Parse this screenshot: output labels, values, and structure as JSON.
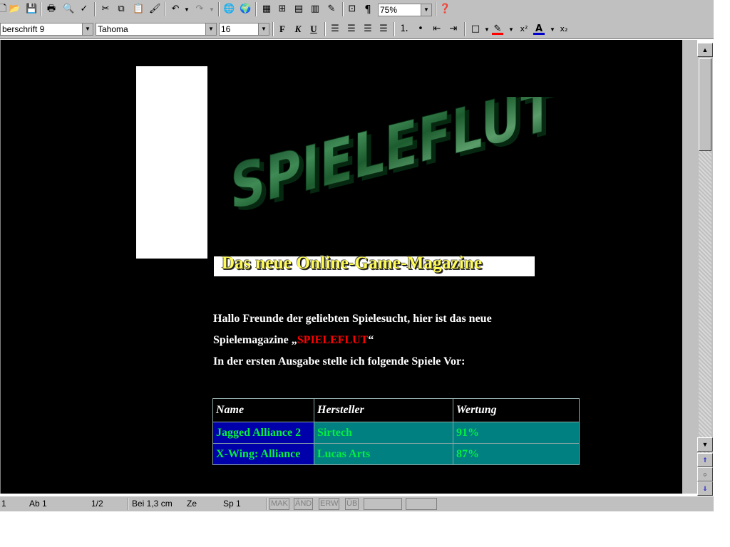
{
  "toolbar_standard": {
    "zoom": "75%"
  },
  "toolbar_format": {
    "style": "berschrift 9",
    "font": "Tahoma",
    "size": "16",
    "bold_label": "F",
    "italic_label": "K",
    "underline_label": "U"
  },
  "document": {
    "logo_text": "SPIELEFLUT",
    "subtitle": "Das neue Online-Game-Magazine",
    "para1": "Hallo Freunde der geliebten Spielesucht, hier ist das neue",
    "para2_prefix": "Spielemagazine „",
    "para2_highlight": "SPIELEFLUT",
    "para2_suffix": "“",
    "para3": "In der ersten Ausgabe stelle ich folgende Spiele Vor:",
    "table": {
      "headers": [
        "Name",
        "Hersteller",
        "Wertung"
      ],
      "rows": [
        [
          "Jagged Alliance 2",
          "Sirtech",
          "91%"
        ],
        [
          "X-Wing: Alliance",
          "Lucas Arts",
          "87%"
        ]
      ]
    }
  },
  "statusbar": {
    "page": "1",
    "section": "Ab  1",
    "pages": "1/2",
    "position": "Bei 1,3 cm",
    "line": "Ze",
    "column": "Sp 1",
    "mak": "MAK",
    "and": "ÄND",
    "erw": "ERW",
    "ub": "ÜB"
  },
  "colors": {
    "page_background": "#000000",
    "highlight_red": "#ff0000",
    "table_green_text": "#00ee44",
    "table_teal": "#008080",
    "table_navy": "#0000aa"
  }
}
